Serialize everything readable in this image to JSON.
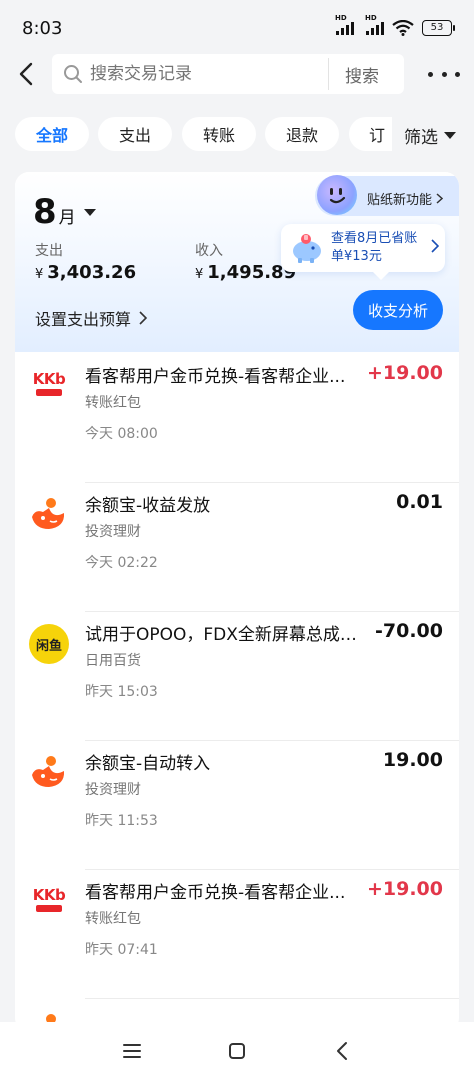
{
  "status": {
    "time": "8:03",
    "hd1": "HD",
    "hd2": "HD",
    "battery": "53"
  },
  "search": {
    "placeholder": "搜索交易记录",
    "button": "搜索"
  },
  "tabs": [
    {
      "label": "全部",
      "active": true
    },
    {
      "label": "支出"
    },
    {
      "label": "转账"
    },
    {
      "label": "退款"
    },
    {
      "label": "订"
    }
  ],
  "filter": {
    "label": "筛选"
  },
  "summary": {
    "month": "8",
    "month_unit": "月",
    "expense_label": "支出",
    "expense_currency": "¥",
    "expense_amount": "3,403.26",
    "income_label": "收入",
    "income_currency": "¥",
    "income_amount": "1,495.89",
    "budget_label": "设置支出预算",
    "analysis_button": "收支分析",
    "sticker_label": "贴纸新功能",
    "saving_tip": "查看8月已省账单¥13元"
  },
  "transactions": [
    {
      "logo": "kkb",
      "title": "看客帮用户金币兑换-看客帮企业...",
      "category": "转账红包",
      "time": "今天 08:00",
      "amount": "+19.00",
      "positive": true
    },
    {
      "logo": "yuebao",
      "title": "余额宝-收益发放",
      "category": "投资理财",
      "time": "今天 02:22",
      "amount": "0.01",
      "positive": false
    },
    {
      "logo": "xianyu",
      "title": "试用于OPOO，FDX全新屏幕总成，...",
      "category": "日用百货",
      "time": "昨天 15:03",
      "amount": "-70.00",
      "positive": false
    },
    {
      "logo": "yuebao",
      "title": "余额宝-自动转入",
      "category": "投资理财",
      "time": "昨天 11:53",
      "amount": "19.00",
      "positive": false
    },
    {
      "logo": "kkb",
      "title": "看客帮用户金币兑换-看客帮企业...",
      "category": "转账红包",
      "time": "昨天 07:41",
      "amount": "+19.00",
      "positive": true
    }
  ],
  "logo_text": {
    "kkb": "KKb",
    "xianyu": "闲鱼"
  },
  "colors": {
    "accent": "#1677ff",
    "positive_amount": "#e2374a",
    "background": "#f3f4f6"
  }
}
